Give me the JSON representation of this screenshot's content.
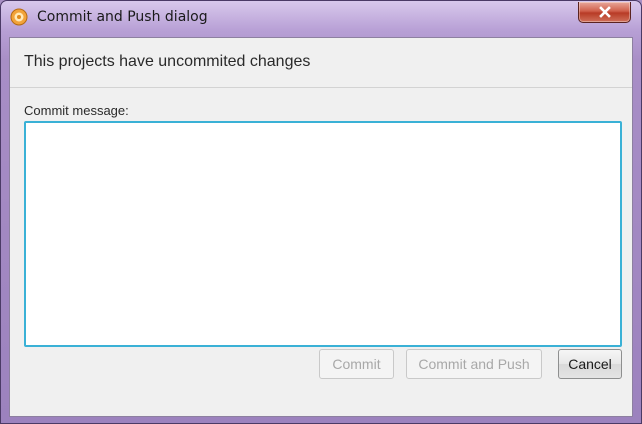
{
  "window": {
    "title": "Commit and Push dialog",
    "app_icon": "app-logo-icon",
    "close_icon": "close-icon"
  },
  "header": {
    "text": "This projects have uncommited changes"
  },
  "form": {
    "commit_label": "Commit message:",
    "commit_value": ""
  },
  "buttons": {
    "commit": {
      "label": "Commit",
      "enabled": false
    },
    "commit_and_push": {
      "label": "Commit and Push",
      "enabled": false
    },
    "cancel": {
      "label": "Cancel",
      "enabled": true
    }
  },
  "colors": {
    "accent_focus": "#3ab1d6",
    "close_button": "#c7492f",
    "frame": "#a88ec6"
  }
}
